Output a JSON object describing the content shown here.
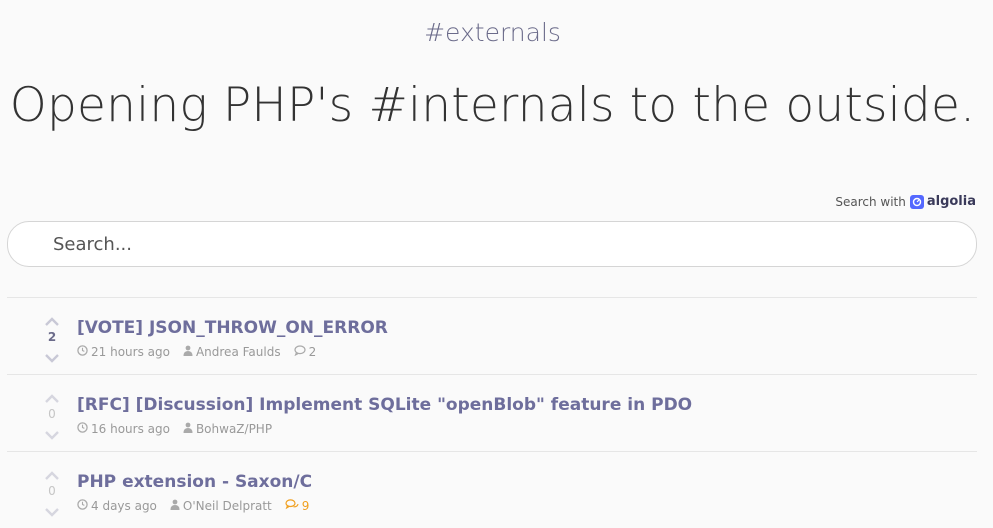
{
  "site": {
    "title": "#externals",
    "tagline": "Opening PHP's #internals to the outside."
  },
  "search": {
    "powered_by": "Search with",
    "provider": "algolia",
    "placeholder": "Search..."
  },
  "threads": [
    {
      "votes": "2",
      "title": "[VOTE] JSON_THROW_ON_ERROR",
      "time": "21 hours ago",
      "author": "Andrea Faulds",
      "replies": "2",
      "hot": false
    },
    {
      "votes": "0",
      "title": "[RFC] [Discussion] Implement SQLite \"openBlob\" feature in PDO",
      "time": "16 hours ago",
      "author": "BohwaZ/PHP",
      "replies": "",
      "hot": false
    },
    {
      "votes": "0",
      "title": "PHP extension - Saxon/C",
      "time": "4 days ago",
      "author": "O'Neil Delpratt",
      "replies": "9",
      "hot": true
    }
  ],
  "colors": {
    "accent": "#6e6e9c",
    "algolia": "#5468ff",
    "hot": "#f0a020"
  }
}
